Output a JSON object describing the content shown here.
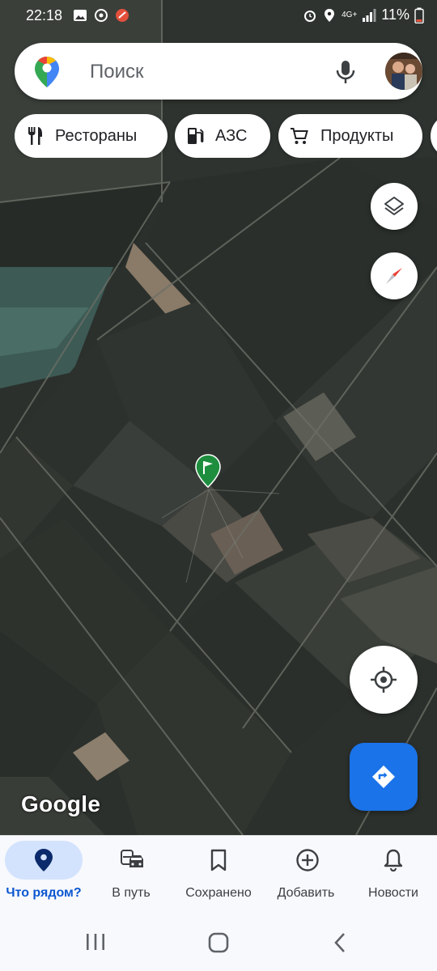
{
  "status_bar": {
    "time": "22:18",
    "network": "4G+",
    "battery": "11%"
  },
  "search": {
    "placeholder": "Поиск"
  },
  "chips": [
    {
      "label": "Рестораны",
      "icon": "restaurant-icon"
    },
    {
      "label": "АЗС",
      "icon": "gas-station-icon"
    },
    {
      "label": "Продукты",
      "icon": "cart-icon"
    }
  ],
  "map": {
    "attribution": "Google",
    "view": "satellite"
  },
  "bottom_nav": {
    "items": [
      {
        "label": "Что рядом?",
        "icon": "location-pin-icon",
        "active": true
      },
      {
        "label": "В путь",
        "icon": "commute-icon",
        "active": false
      },
      {
        "label": "Сохранено",
        "icon": "bookmark-icon",
        "active": false
      },
      {
        "label": "Добавить",
        "icon": "add-circle-icon",
        "active": false
      },
      {
        "label": "Новости",
        "icon": "bell-icon",
        "active": false
      }
    ]
  },
  "colors": {
    "accent": "#1a73e8",
    "active_pill": "#d3e3fd",
    "marker": "#1e8e3e"
  }
}
